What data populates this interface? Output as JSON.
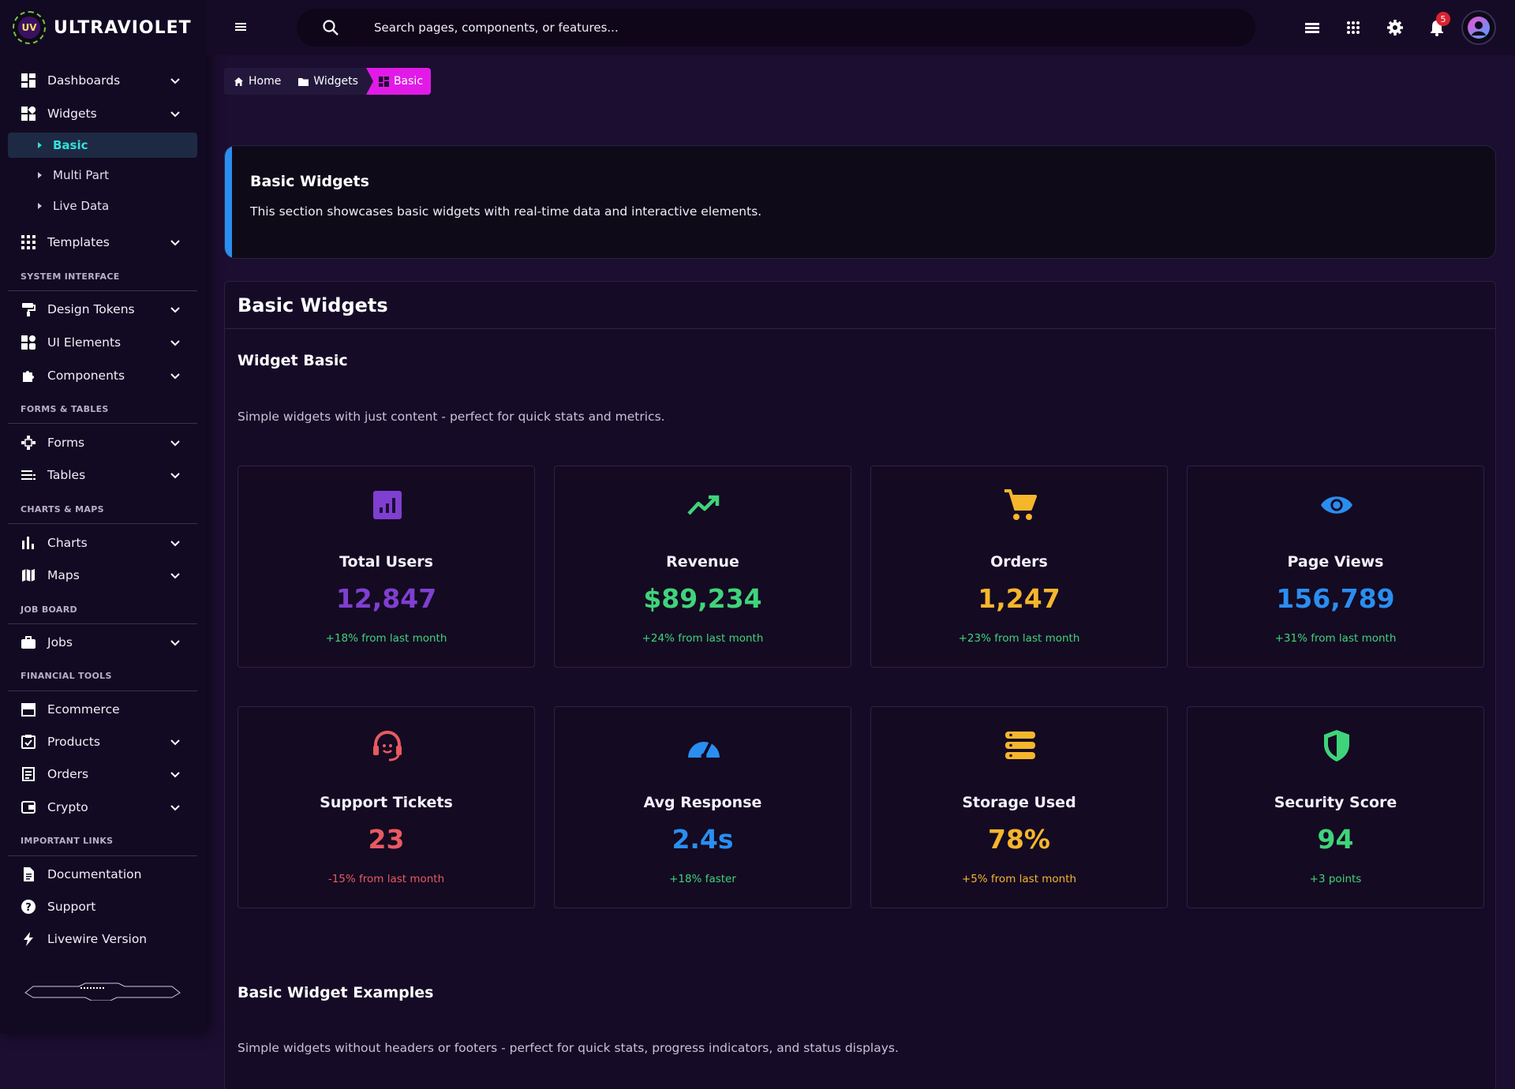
{
  "brand": {
    "name": "ULTRAVIOLET",
    "logo_text": "UV"
  },
  "sidebar": {
    "items": [
      {
        "label": "Dashboards"
      },
      {
        "label": "Widgets"
      },
      {
        "label": "Templates"
      },
      {
        "label": "Design Tokens"
      },
      {
        "label": "UI Elements"
      },
      {
        "label": "Components"
      },
      {
        "label": "Forms"
      },
      {
        "label": "Tables"
      },
      {
        "label": "Charts"
      },
      {
        "label": "Maps"
      },
      {
        "label": "Jobs"
      },
      {
        "label": "Ecommerce"
      },
      {
        "label": "Products"
      },
      {
        "label": "Orders"
      },
      {
        "label": "Crypto"
      },
      {
        "label": "Documentation"
      },
      {
        "label": "Support"
      },
      {
        "label": "Livewire Version"
      }
    ],
    "widget_subitems": [
      {
        "label": "Basic",
        "active": true
      },
      {
        "label": "Multi Part"
      },
      {
        "label": "Live Data"
      }
    ],
    "sections": [
      "SYSTEM INTERFACE",
      "FORMS & TABLES",
      "CHARTS & MAPS",
      "JOB BOARD",
      "FINANCIAL TOOLS",
      "IMPORTANT LINKS"
    ]
  },
  "topbar": {
    "search_placeholder": "Search pages, components, or features...",
    "notification_count": "5"
  },
  "breadcrumb": [
    "Home",
    "Widgets",
    "Basic"
  ],
  "intro": {
    "title": "Basic Widgets",
    "description": "This section showcases basic widgets with real-time data and interactive elements."
  },
  "panel": {
    "title": "Basic Widgets",
    "section1_title": "Widget Basic",
    "section1_desc": "Simple widgets with just content - perfect for quick stats and metrics.",
    "section2_title": "Basic Widget Examples",
    "section2_desc": "Simple widgets without headers or footers - perfect for quick stats, progress indicators, and status displays."
  },
  "widgets": [
    {
      "label": "Total Users",
      "value": "12,847",
      "note": "+18% from last month",
      "icon": "chart-box-icon",
      "color": "#7f3fd0",
      "note_color": "#3fd47a"
    },
    {
      "label": "Revenue",
      "value": "$89,234",
      "note": "+24% from last month",
      "icon": "trending-up-icon",
      "color": "#3fd47a",
      "note_color": "#3fd47a"
    },
    {
      "label": "Orders",
      "value": "1,247",
      "note": "+23% from last month",
      "icon": "cart-icon",
      "color": "#f6b62c",
      "note_color": "#3fd47a"
    },
    {
      "label": "Page Views",
      "value": "156,789",
      "note": "+31% from last month",
      "icon": "eye-icon",
      "color": "#2a8ef0",
      "note_color": "#3fd47a"
    },
    {
      "label": "Support Tickets",
      "value": "23",
      "note": "-15% from last month",
      "icon": "headset-icon",
      "color": "#e85a60",
      "note_color": "#e85a60"
    },
    {
      "label": "Avg Response",
      "value": "2.4s",
      "note": "+18% faster",
      "icon": "speedometer-icon",
      "color": "#2a8ef0",
      "note_color": "#3fd47a"
    },
    {
      "label": "Storage Used",
      "value": "78%",
      "note": "+5% from last month",
      "icon": "storage-icon",
      "color": "#f6b62c",
      "note_color": "#f6b62c"
    },
    {
      "label": "Security Score",
      "value": "94",
      "note": "+3 points",
      "icon": "shield-icon",
      "color": "#3fd47a",
      "note_color": "#3fd47a"
    }
  ]
}
